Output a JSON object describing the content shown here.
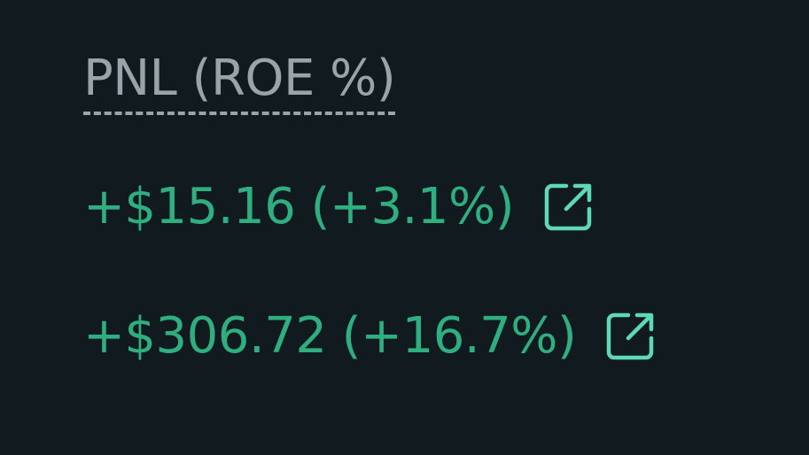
{
  "header": {
    "title": "PNL (ROE %)"
  },
  "rows": [
    {
      "pnl_text": "+$15.16 (+3.1%)",
      "share_icon": "external-link-icon"
    },
    {
      "pnl_text": "+$306.72 (+16.7%)",
      "share_icon": "external-link-icon"
    }
  ],
  "colors": {
    "background": "#111a1f",
    "header_text": "#9aa3a7",
    "positive": "#2fae80",
    "icon": "#5fd9b4"
  }
}
